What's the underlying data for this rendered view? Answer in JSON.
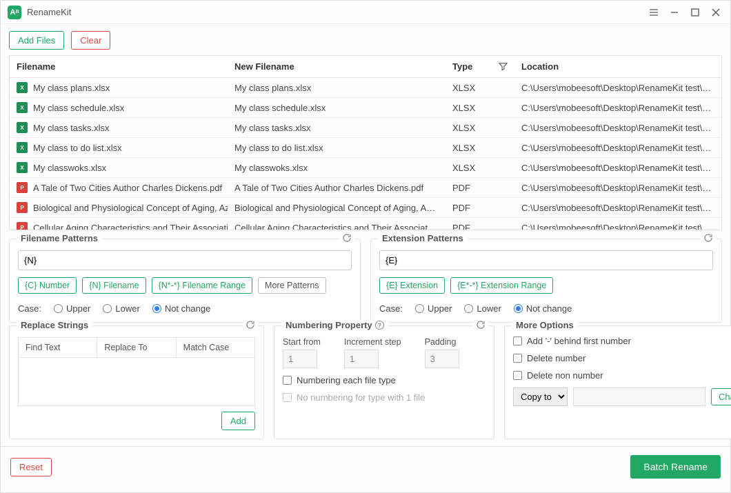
{
  "app": {
    "title": "RenameKit"
  },
  "toolbar": {
    "add_files": "Add Files",
    "clear": "Clear"
  },
  "table": {
    "columns": {
      "filename": "Filename",
      "new_filename": "New Filename",
      "type": "Type",
      "location": "Location"
    },
    "rows": [
      {
        "icon": "xlsx",
        "filename": "My class plans.xlsx",
        "new_filename": "My class plans.xlsx",
        "type": "XLSX",
        "location": "C:\\Users\\mobeesoft\\Desktop\\RenameKit test\\Sheets"
      },
      {
        "icon": "xlsx",
        "filename": "My class schedule.xlsx",
        "new_filename": "My class schedule.xlsx",
        "type": "XLSX",
        "location": "C:\\Users\\mobeesoft\\Desktop\\RenameKit test\\Sheets"
      },
      {
        "icon": "xlsx",
        "filename": "My class tasks.xlsx",
        "new_filename": "My class tasks.xlsx",
        "type": "XLSX",
        "location": "C:\\Users\\mobeesoft\\Desktop\\RenameKit test\\Sheets"
      },
      {
        "icon": "xlsx",
        "filename": "My class to do list.xlsx",
        "new_filename": "My class to do list.xlsx",
        "type": "XLSX",
        "location": "C:\\Users\\mobeesoft\\Desktop\\RenameKit test\\Sheets"
      },
      {
        "icon": "xlsx",
        "filename": "My classwoks.xlsx",
        "new_filename": "My classwoks.xlsx",
        "type": "XLSX",
        "location": "C:\\Users\\mobeesoft\\Desktop\\RenameKit test\\Sheets"
      },
      {
        "icon": "pdf",
        "filename": "A Tale of Two Cities Author Charles Dickens.pdf",
        "new_filename": "A Tale of Two Cities Author Charles Dickens.pdf",
        "type": "PDF",
        "location": "C:\\Users\\mobeesoft\\Desktop\\RenameKit test\\PDFs"
      },
      {
        "icon": "pdf",
        "filename": "Biological and Physiological Concept of Aging, Azza S.pdf",
        "new_filename": "Biological and Physiological Concept of Aging, Azza S.pdf",
        "type": "PDF",
        "location": "C:\\Users\\mobeesoft\\Desktop\\RenameKit test\\PDFs"
      },
      {
        "icon": "pdf",
        "filename": "Cellular Aging Characteristics and Their Association with.pdf",
        "new_filename": "Cellular Aging Characteristics and Their Association wi",
        "type": "PDF",
        "location": "C:\\Users\\mobeesoft\\Desktop\\RenameKit test\\PDFs"
      }
    ]
  },
  "filename_patterns": {
    "title": "Filename Patterns",
    "value": "{N}",
    "chips": {
      "c_number": "{C} Number",
      "n_filename": "{N} Filename",
      "n_range": "{N*-*} Filename Range",
      "more": "More Patterns"
    },
    "case_label": "Case:",
    "case": {
      "upper": "Upper",
      "lower": "Lower",
      "notchange": "Not change"
    }
  },
  "extension_patterns": {
    "title": "Extension Patterns",
    "value": "{E}",
    "chips": {
      "e_extension": "{E} Extension",
      "e_range": "{E*-*} Extension Range"
    },
    "case_label": "Case:",
    "case": {
      "upper": "Upper",
      "lower": "Lower",
      "notchange": "Not change"
    }
  },
  "replace": {
    "title": "Replace Strings",
    "columns": {
      "find": "Find Text",
      "replace": "Replace To",
      "match": "Match Case"
    },
    "add": "Add"
  },
  "numbering": {
    "title": "Numbering Property",
    "start_label": "Start from",
    "start_value": "1",
    "step_label": "Increment step",
    "step_value": "1",
    "padding_label": "Padding",
    "padding_value": "3",
    "each_type": "Numbering each file type",
    "no_numbering_one": "No numbering for type with 1 file"
  },
  "more": {
    "title": "More Options",
    "add_dash": "Add '-' behind first number",
    "delete_number": "Delete number",
    "delete_non_number": "Delete non number",
    "copy_to": "Copy to",
    "change": "Change"
  },
  "footer": {
    "reset": "Reset",
    "batch": "Batch Rename"
  }
}
